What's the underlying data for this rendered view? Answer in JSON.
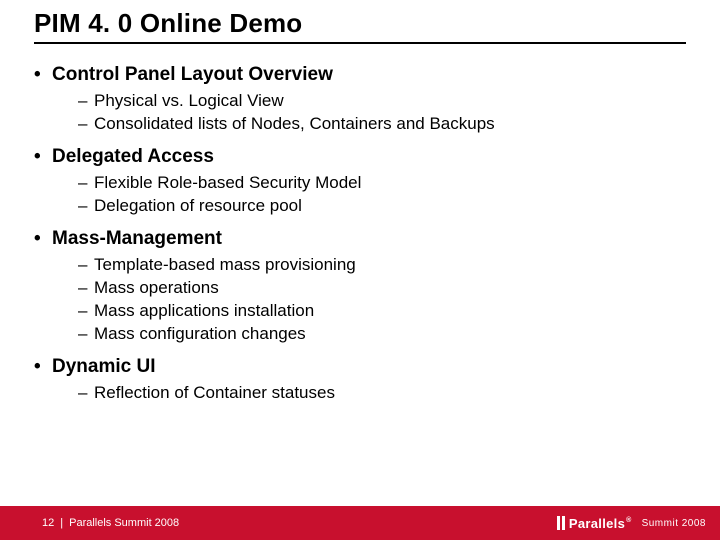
{
  "title": "PIM 4. 0 Online Demo",
  "sections": [
    {
      "heading": "Control Panel Layout Overview",
      "items": [
        "Physical vs. Logical View",
        "Consolidated lists of Nodes, Containers and Backups"
      ]
    },
    {
      "heading": "Delegated Access",
      "items": [
        "Flexible Role-based Security Model",
        "Delegation of resource pool"
      ]
    },
    {
      "heading": "Mass-Management",
      "items": [
        "Template-based mass provisioning",
        "Mass operations",
        "Mass applications installation",
        "Mass configuration changes"
      ]
    },
    {
      "heading": "Dynamic UI",
      "items": [
        "Reflection of Container statuses"
      ]
    }
  ],
  "footer": {
    "page": "12",
    "event": "Parallels Summit 2008",
    "brand": "Parallels",
    "summit": "Summit 2008"
  }
}
